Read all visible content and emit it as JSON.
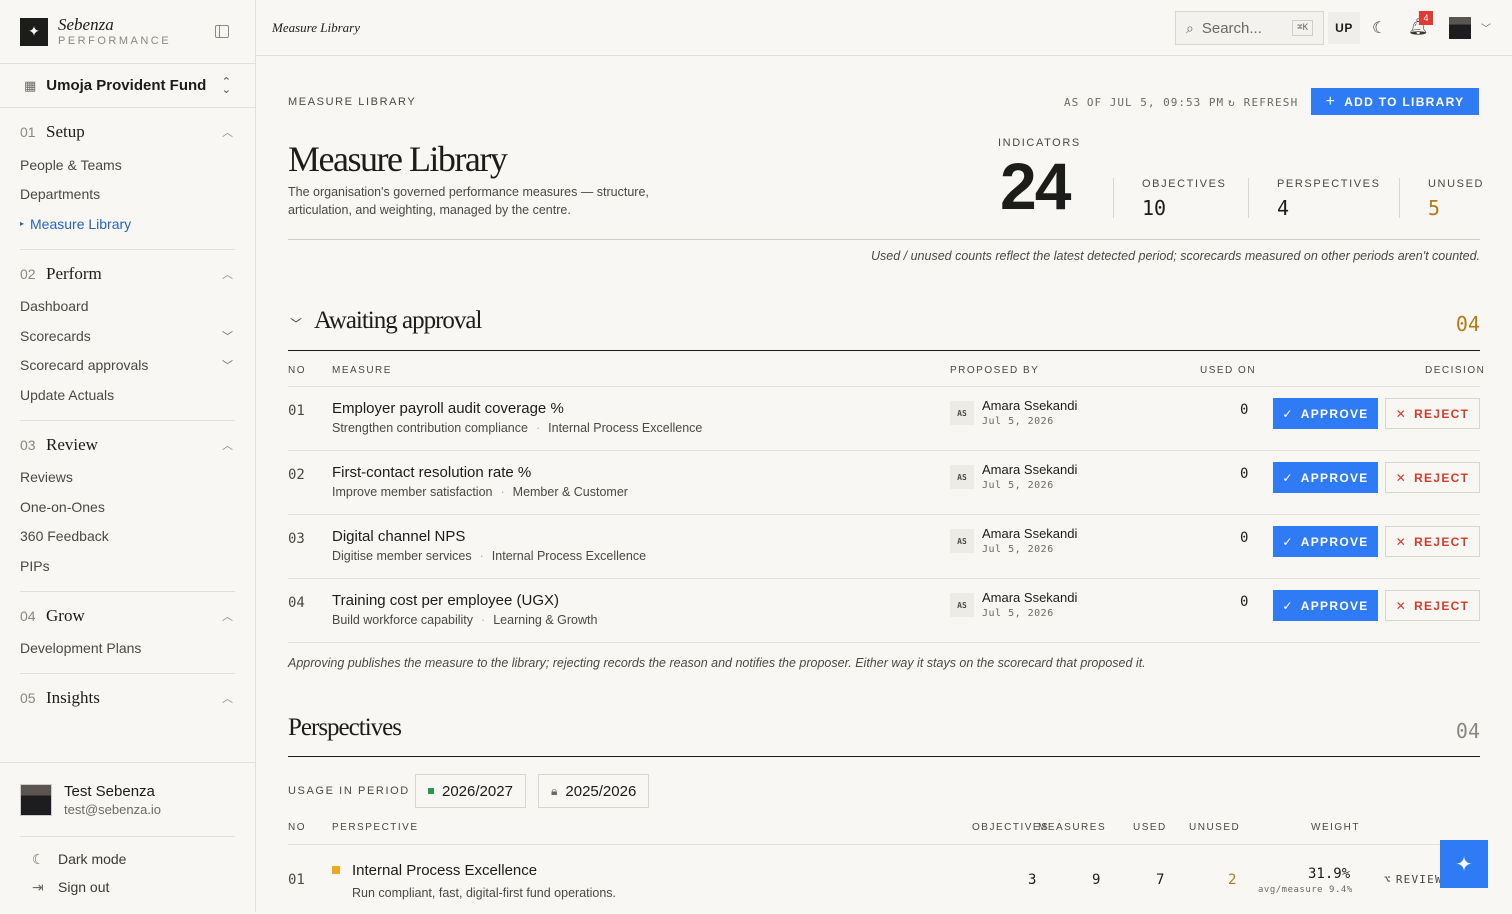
{
  "sidebar": {
    "brand": {
      "name": "Sebenza",
      "sub": "PERFORMANCE"
    },
    "org": "Umoja Provident Fund",
    "groups": [
      {
        "num": "01",
        "title": "Setup",
        "items": [
          "People & Teams",
          "Departments",
          "Measure Library"
        ]
      },
      {
        "num": "02",
        "title": "Perform",
        "items": [
          "Dashboard",
          "Scorecards",
          "Scorecard approvals",
          "Update Actuals"
        ]
      },
      {
        "num": "03",
        "title": "Review",
        "items": [
          "Reviews",
          "One-on-Ones",
          "360 Feedback",
          "PIPs"
        ]
      },
      {
        "num": "04",
        "title": "Grow",
        "items": [
          "Development Plans"
        ]
      },
      {
        "num": "05",
        "title": "Insights",
        "items": []
      }
    ],
    "user": {
      "name": "Test Sebenza",
      "email": "test@sebenza.io"
    },
    "dark_mode": "Dark mode",
    "sign_out": "Sign out"
  },
  "topbar": {
    "breadcrumb": "Measure Library",
    "search_label": "Search...",
    "search_kbd": "⌘K",
    "user_initials": "UP",
    "notification_count": "4"
  },
  "header": {
    "eyebrow": "MEASURE LIBRARY",
    "as_of": "AS OF JUL 5, 09:53 PM",
    "refresh": "REFRESH",
    "add_button": "ADD TO LIBRARY",
    "title": "Measure Library",
    "description": "The organisation's governed performance measures — structure, articulation, and weighting, managed by the centre."
  },
  "stats": {
    "indicators_label": "INDICATORS",
    "indicators": "24",
    "objectives_label": "OBJECTIVES",
    "objectives": "10",
    "perspectives_label": "PERSPECTIVES",
    "perspectives": "4",
    "unused_label": "UNUSED",
    "unused": "5"
  },
  "counts_note": "Used / unused counts reflect the latest detected period; scorecards measured on other periods aren't counted.",
  "awaiting": {
    "title": "Awaiting approval",
    "count": "04",
    "columns": {
      "no": "NO",
      "measure": "MEASURE",
      "proposed_by": "PROPOSED BY",
      "used_on": "USED ON",
      "decision": "DECISION"
    },
    "approve_label": "APPROVE",
    "reject_label": "REJECT",
    "rows": [
      {
        "no": "01",
        "name": "Employer payroll audit coverage %",
        "objective": "Strengthen contribution compliance",
        "perspective": "Internal Process Excellence",
        "initials": "AS",
        "proposer": "Amara Ssekandi",
        "date": "Jul 5, 2026",
        "used": "0"
      },
      {
        "no": "02",
        "name": "First-contact resolution rate %",
        "objective": "Improve member satisfaction",
        "perspective": "Member & Customer",
        "initials": "AS",
        "proposer": "Amara Ssekandi",
        "date": "Jul 5, 2026",
        "used": "0"
      },
      {
        "no": "03",
        "name": "Digital channel NPS",
        "objective": "Digitise member services",
        "perspective": "Internal Process Excellence",
        "initials": "AS",
        "proposer": "Amara Ssekandi",
        "date": "Jul 5, 2026",
        "used": "0"
      },
      {
        "no": "04",
        "name": "Training cost per employee (UGX)",
        "objective": "Build workforce capability",
        "perspective": "Learning & Growth",
        "initials": "AS",
        "proposer": "Amara Ssekandi",
        "date": "Jul 5, 2026",
        "used": "0"
      }
    ],
    "footnote": "Approving publishes the measure to the library; rejecting records the reason and notifies the proposer. Either way it stays on the scorecard that proposed it."
  },
  "perspectives": {
    "title": "Perspectives",
    "count": "04",
    "usage_label": "USAGE IN PERIOD",
    "periods": [
      "2026/2027",
      "2025/2026"
    ],
    "columns": {
      "no": "NO",
      "perspective": "PERSPECTIVE",
      "objectives": "OBJECTIVES",
      "measures": "MEASURES",
      "used": "USED",
      "unused": "UNUSED",
      "weight": "WEIGHT"
    },
    "rows": [
      {
        "no": "01",
        "name": "Internal Process Excellence",
        "description": "Run compliant, fast, digital-first fund operations.",
        "objectives": "3",
        "measures": "9",
        "used": "7",
        "unused": "2",
        "weight": "31.9%",
        "avg": "avg/measure 9.4%",
        "action": "REVIEW",
        "color": "#f0a81c"
      }
    ]
  },
  "colors": {
    "accent": "#2f7bf5",
    "reject": "#d23c2f",
    "unused": "#b47a14",
    "badge": "#e23a30"
  }
}
